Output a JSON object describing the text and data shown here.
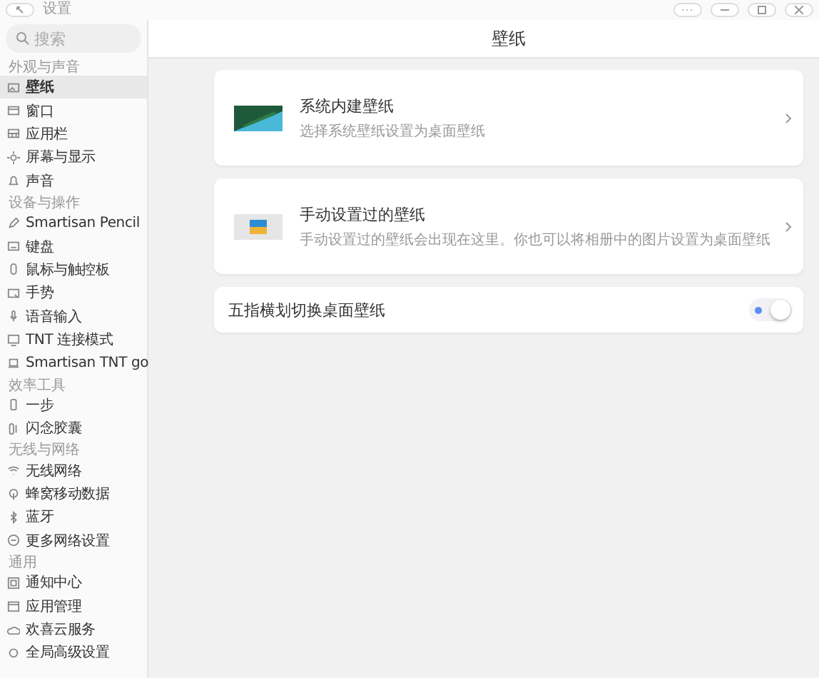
{
  "window": {
    "title": "设置"
  },
  "search": {
    "placeholder": "搜索"
  },
  "sidebar": {
    "sections": [
      {
        "title": "外观与声音",
        "items": [
          {
            "label": "壁纸",
            "selected": true
          },
          {
            "label": "窗口",
            "selected": false
          },
          {
            "label": "应用栏",
            "selected": false
          },
          {
            "label": "屏幕与显示",
            "selected": false
          },
          {
            "label": "声音",
            "selected": false
          }
        ]
      },
      {
        "title": "设备与操作",
        "items": [
          {
            "label": "Smartisan Pencil",
            "selected": false
          },
          {
            "label": "键盘",
            "selected": false
          },
          {
            "label": "鼠标与触控板",
            "selected": false
          },
          {
            "label": "手势",
            "selected": false
          },
          {
            "label": "语音输入",
            "selected": false
          },
          {
            "label": "TNT 连接模式",
            "selected": false
          },
          {
            "label": "Smartisan TNT go",
            "selected": false
          }
        ]
      },
      {
        "title": "效率工具",
        "items": [
          {
            "label": "一步",
            "selected": false
          },
          {
            "label": "闪念胶囊",
            "selected": false
          }
        ]
      },
      {
        "title": "无线与网络",
        "items": [
          {
            "label": "无线网络",
            "selected": false
          },
          {
            "label": "蜂窝移动数据",
            "selected": false
          },
          {
            "label": "蓝牙",
            "selected": false
          },
          {
            "label": "更多网络设置",
            "selected": false
          }
        ]
      },
      {
        "title": "通用",
        "items": [
          {
            "label": "通知中心",
            "selected": false
          },
          {
            "label": "应用管理",
            "selected": false
          },
          {
            "label": "欢喜云服务",
            "selected": false
          },
          {
            "label": "全局高级设置",
            "selected": false
          }
        ]
      }
    ]
  },
  "page": {
    "title": "壁纸",
    "cards": [
      {
        "kind": "link",
        "title": "系统内建壁纸",
        "subtitle": "选择系统壁纸设置为桌面壁纸"
      },
      {
        "kind": "link",
        "title": "手动设置过的壁纸",
        "subtitle": "手动设置过的壁纸会出现在这里。你也可以将相册中的图片设置为桌面壁纸"
      },
      {
        "kind": "toggle",
        "title": "五指横划切换桌面壁纸",
        "on": true
      }
    ]
  }
}
